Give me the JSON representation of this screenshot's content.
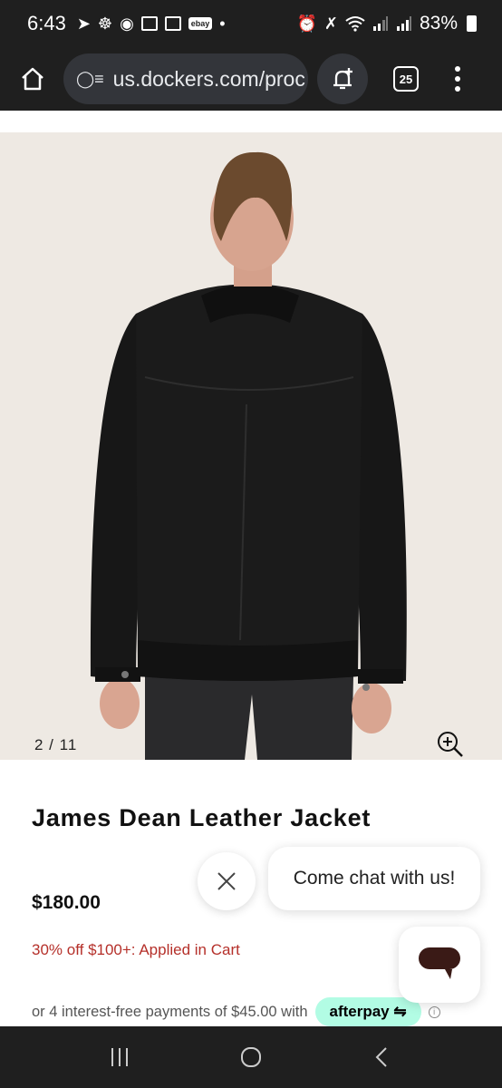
{
  "status_bar": {
    "time": "6:43",
    "battery": "83%",
    "ebay_label": "ebay"
  },
  "browser": {
    "url": "us.dockers.com/proc",
    "tab_count": "25"
  },
  "product": {
    "image_counter": "2 / 11",
    "title": "James Dean Leather Jacket",
    "price": "$180.00",
    "promo": "30% off $100+: Applied in Cart",
    "afterpay_text": "or 4 interest-free payments of $45.00 with",
    "afterpay_brand": "afterpay"
  },
  "chat": {
    "prompt": "Come chat with us!"
  },
  "colors": {
    "system_bar": "#1f1f1f",
    "image_bg": "#eee9e3",
    "promo_red": "#b5302a",
    "afterpay_mint": "#b2fce4"
  },
  "icons": {
    "home": "home-icon",
    "bell": "notification-add-icon",
    "tabs": "tabs-icon",
    "menu": "more-vert-icon",
    "zoom": "zoom-in-icon",
    "close": "close-icon",
    "chat": "chat-icon"
  }
}
